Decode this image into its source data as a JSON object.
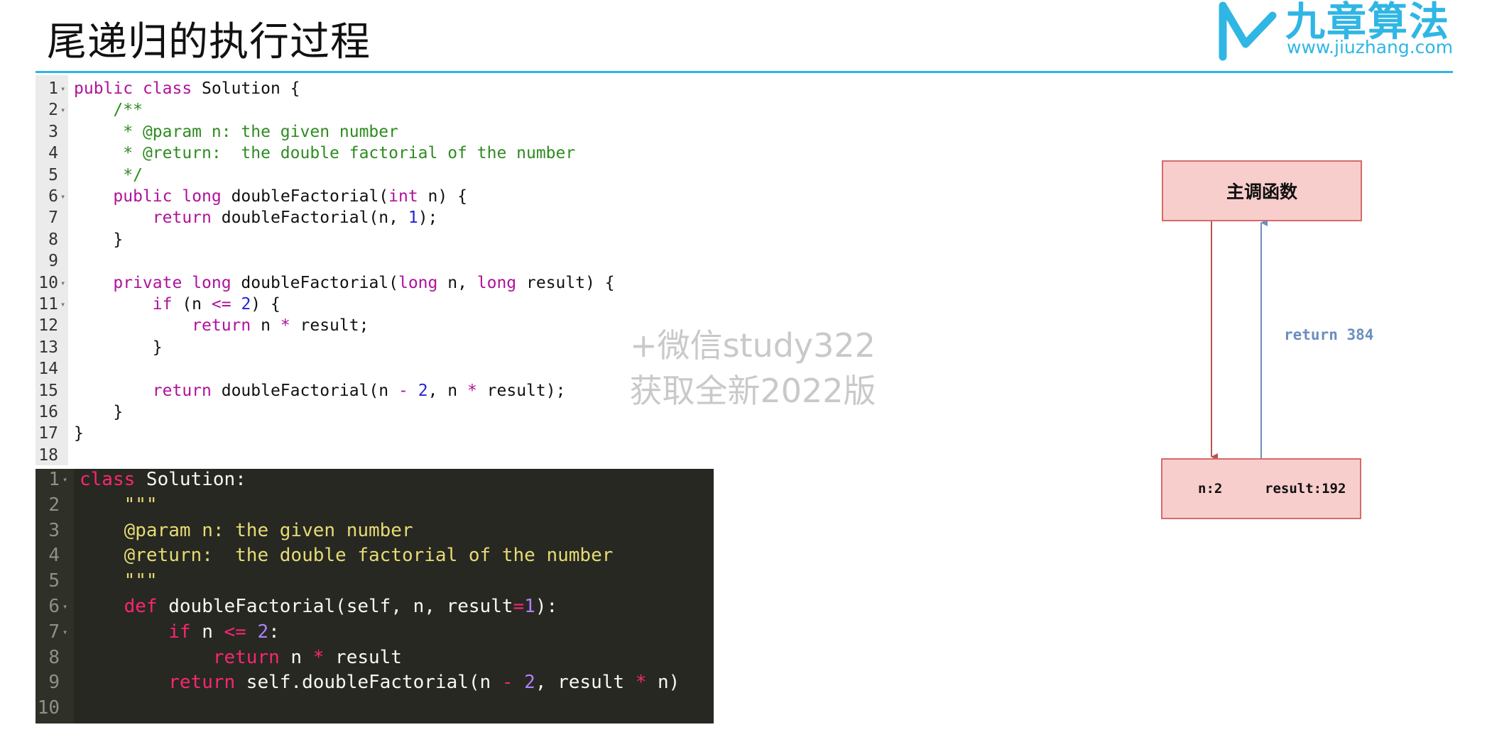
{
  "page": {
    "title": "尾递归的执行过程"
  },
  "logo": {
    "name": "九章算法",
    "url": "www.jiuzhang.com"
  },
  "java_code": {
    "lines": [
      {
        "n": "1",
        "fold": true
      },
      {
        "n": "2",
        "fold": true
      },
      {
        "n": "3",
        "fold": false
      },
      {
        "n": "4",
        "fold": false
      },
      {
        "n": "5",
        "fold": false
      },
      {
        "n": "6",
        "fold": true
      },
      {
        "n": "7",
        "fold": false
      },
      {
        "n": "8",
        "fold": false
      },
      {
        "n": "9",
        "fold": false
      },
      {
        "n": "10",
        "fold": true
      },
      {
        "n": "11",
        "fold": true
      },
      {
        "n": "12",
        "fold": false
      },
      {
        "n": "13",
        "fold": false
      },
      {
        "n": "14",
        "fold": false
      },
      {
        "n": "15",
        "fold": false
      },
      {
        "n": "16",
        "fold": false
      },
      {
        "n": "17",
        "fold": false
      },
      {
        "n": "18",
        "fold": false
      }
    ]
  },
  "python_code": {
    "line_numbers": [
      "1",
      "2",
      "3",
      "4",
      "5",
      "6",
      "7",
      "8",
      "9",
      "10"
    ]
  },
  "watermark": {
    "line1": "+微信study322",
    "line2": "获取全新2022版"
  },
  "diagram": {
    "caller_label": "主调函数",
    "frame_n": "n:2",
    "frame_result": "result:192",
    "return_label": "return 384",
    "colors": {
      "box_fill": "#f8cecc",
      "box_border": "#d46b6b",
      "call_arrow": "#b85450",
      "return_arrow": "#6c8ebf"
    }
  },
  "colors": {
    "accent": "#2fb6e4",
    "py_bg": "#272822"
  }
}
